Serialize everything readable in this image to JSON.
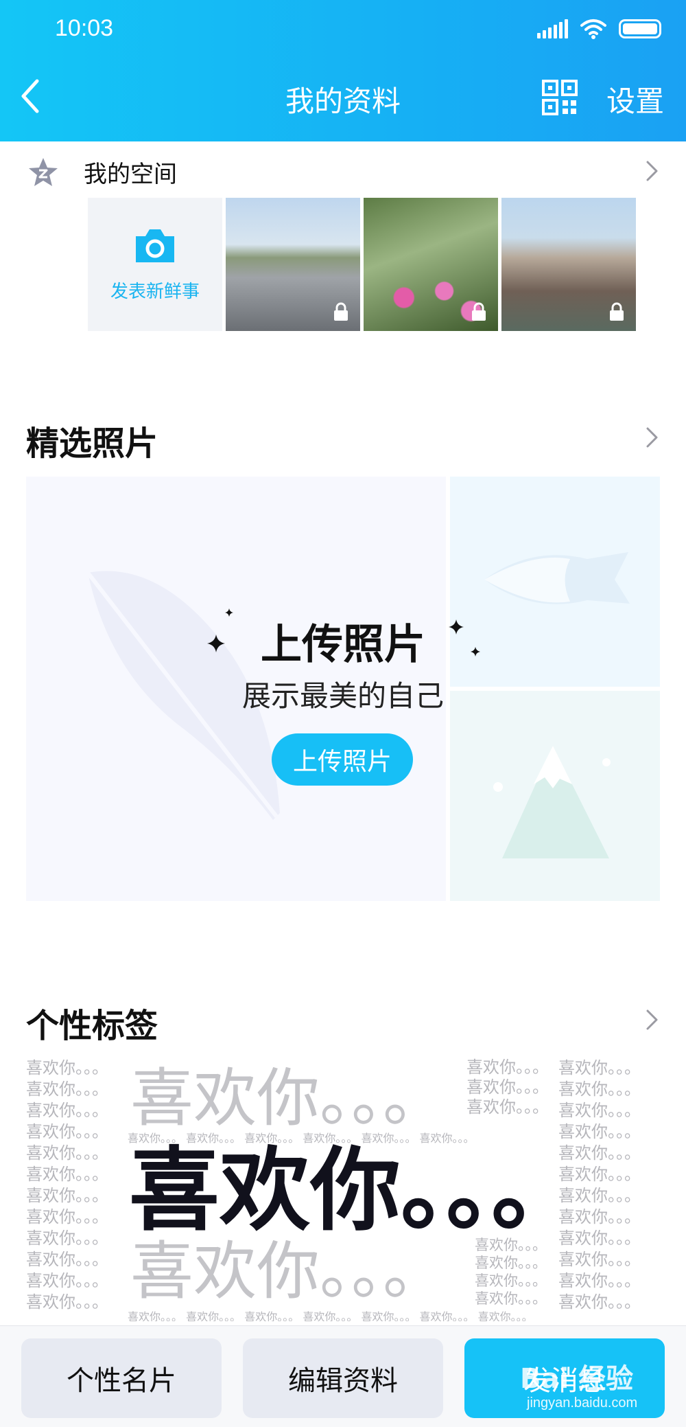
{
  "status_bar": {
    "time": "10:03"
  },
  "header": {
    "title": "我的资料",
    "settings_label": "设置"
  },
  "space": {
    "label": "我的空间",
    "post_label": "发表新鲜事",
    "photos": [
      "street-photo",
      "flowers-photo",
      "canal-photo"
    ]
  },
  "featured": {
    "title": "精选照片",
    "heading": "上传照片",
    "subtitle": "展示最美的自己",
    "button_label": "上传照片"
  },
  "tags": {
    "title": "个性标签",
    "big_dark": "喜欢你。。。",
    "big_grey": "喜欢你。。。",
    "small": "喜欢你。。。"
  },
  "bottom_bar": {
    "card_label": "个性名片",
    "edit_label": "编辑资料",
    "post_label": "发消息"
  },
  "watermark": {
    "text": "Bai 经验",
    "url": "jingyan.baidu.com"
  },
  "colors": {
    "accent": "#16c2f7",
    "header_start": "#14c6f6",
    "header_end": "#1aa1f3"
  }
}
